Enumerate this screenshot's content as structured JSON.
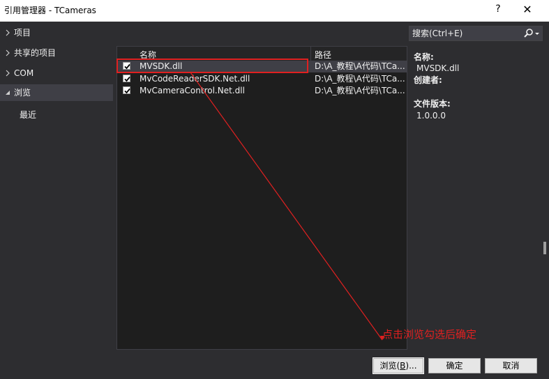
{
  "window": {
    "title": "引用管理器 - TCameras",
    "help_label": "?",
    "close_label": "✕"
  },
  "nav": {
    "items": [
      {
        "label": "项目"
      },
      {
        "label": "共享的项目"
      },
      {
        "label": "COM"
      },
      {
        "label": "浏览"
      }
    ],
    "sub_items": [
      {
        "label": "最近"
      }
    ]
  },
  "list": {
    "headers": {
      "name": "名称",
      "path": "路径"
    },
    "rows": [
      {
        "name": "MVSDK.dll",
        "path": "D:\\A_教程\\A代码\\TCa...",
        "checked": true
      },
      {
        "name": "MvCodeReaderSDK.Net.dll",
        "path": "D:\\A_教程\\A代码\\TCa...",
        "checked": true
      },
      {
        "name": "MvCameraControl.Net.dll",
        "path": "D:\\A_教程\\A代码\\TCa...",
        "checked": true
      }
    ]
  },
  "search": {
    "placeholder": "搜索(Ctrl+E)",
    "icon": "search-icon"
  },
  "details": {
    "name_label": "名称:",
    "name_value": "MVSDK.dll",
    "creator_label": "创建者:",
    "version_label": "文件版本:",
    "version_value": "1.0.0.0"
  },
  "buttons": {
    "browse_text": "浏览(",
    "browse_accel": "B",
    "browse_tail": ")...",
    "ok": "确定",
    "cancel": "取消"
  },
  "annotation": {
    "text": "点击浏览勾选后确定",
    "color": "#e02020"
  }
}
